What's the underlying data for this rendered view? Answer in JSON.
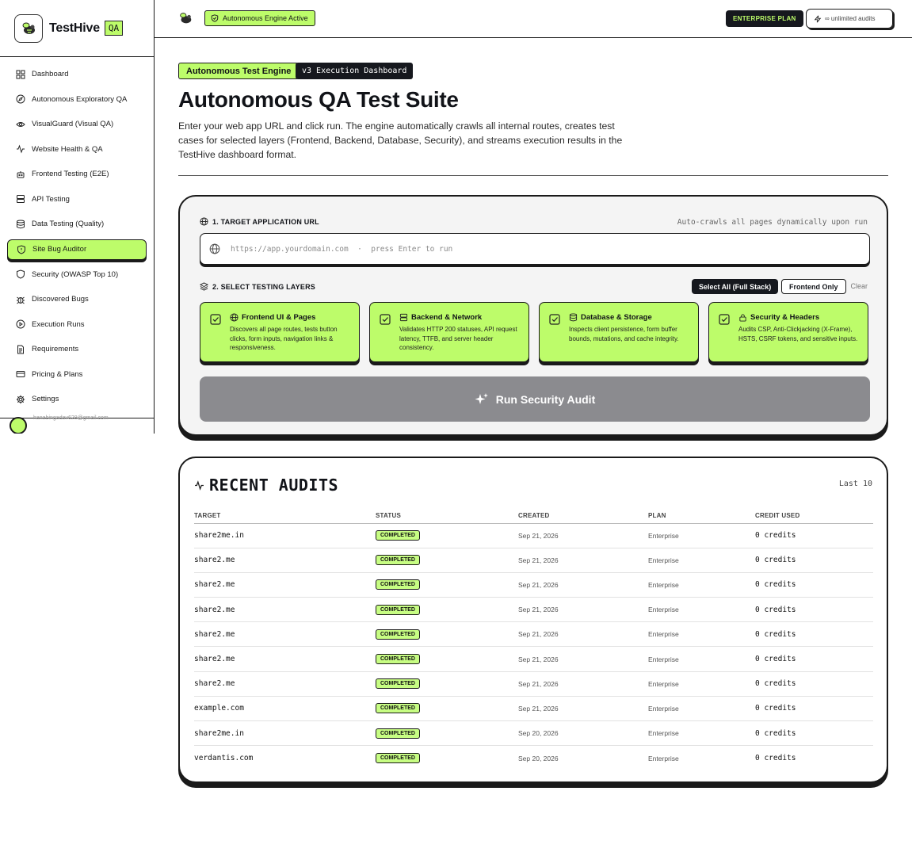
{
  "brand": {
    "name": "TestHive",
    "badge": "QA"
  },
  "sidebar": {
    "items": [
      {
        "label": "Dashboard",
        "icon": "grid-icon"
      },
      {
        "label": "Autonomous Exploratory QA",
        "icon": "compass-icon"
      },
      {
        "label": "VisualGuard (Visual QA)",
        "icon": "eye-icon"
      },
      {
        "label": "Website Health & QA",
        "icon": "activity-icon"
      },
      {
        "label": "Frontend Testing (E2E)",
        "icon": "robot-icon"
      },
      {
        "label": "API Testing",
        "icon": "server-icon"
      },
      {
        "label": "Data Testing (Quality)",
        "icon": "database-icon"
      },
      {
        "label": "Site Bug Auditor",
        "icon": "shield-icon",
        "active": true
      },
      {
        "label": "Security (OWASP Top 10)",
        "icon": "shield-check-icon"
      },
      {
        "label": "Discovered Bugs",
        "icon": "bug-icon"
      },
      {
        "label": "Execution Runs",
        "icon": "play-circle-icon"
      },
      {
        "label": "Requirements",
        "icon": "document-icon"
      },
      {
        "label": "Pricing & Plans",
        "icon": "credit-card-icon"
      },
      {
        "label": "Settings",
        "icon": "gear-icon"
      }
    ],
    "user_email": "hanabingadav628@gmail.com"
  },
  "topbar": {
    "engine_status": "Autonomous Engine Active",
    "plan": "ENTERPRISE PLAN",
    "audits": "∞ unlimited audits"
  },
  "header": {
    "chip_primary": "Autonomous Test Engine",
    "chip_secondary": "v3 Execution Dashboard",
    "title": "Autonomous QA Test Suite",
    "description": "Enter your web app URL and click run. The engine automatically crawls all internal routes, creates test cases for selected layers (Frontend, Backend, Database, Security), and streams execution results in the TestHive dashboard format."
  },
  "config": {
    "url_label": "1. TARGET APPLICATION URL",
    "url_hint": "Auto-crawls all pages dynamically upon run",
    "url_placeholder": "https://app.yourdomain.com  ·  press Enter to run",
    "layers_label": "2. SELECT TESTING LAYERS",
    "select_all": "Select All (Full Stack)",
    "frontend_only": "Frontend Only",
    "clear": "Clear",
    "layers": [
      {
        "title": "Frontend UI & Pages",
        "icon": "globe-icon",
        "desc": "Discovers all page routes, tests button clicks, form inputs, navigation links & responsiveness.",
        "checked": true
      },
      {
        "title": "Backend & Network",
        "icon": "server-icon",
        "desc": "Validates HTTP 200 statuses, API request latency, TTFB, and server header consistency.",
        "checked": true
      },
      {
        "title": "Database & Storage",
        "icon": "database-icon",
        "desc": "Inspects client persistence, form buffer bounds, mutations, and cache integrity.",
        "checked": true
      },
      {
        "title": "Security & Headers",
        "icon": "lock-icon",
        "desc": "Audits CSP, Anti-Clickjacking (X-Frame), HSTS, CSRF tokens, and sensitive inputs.",
        "checked": true
      }
    ],
    "run_label": "Run Security Audit"
  },
  "audits": {
    "title": "RECENT AUDITS",
    "subtitle": "Last 10",
    "columns": [
      "TARGET",
      "STATUS",
      "CREATED",
      "PLAN",
      "CREDIT USED"
    ],
    "rows": [
      {
        "target": "share2me.in",
        "status": "COMPLETED",
        "created": "Sep 21, 2026",
        "plan": "Enterprise",
        "credits": "0 credits"
      },
      {
        "target": "share2.me",
        "status": "COMPLETED",
        "created": "Sep 21, 2026",
        "plan": "Enterprise",
        "credits": "0 credits"
      },
      {
        "target": "share2.me",
        "status": "COMPLETED",
        "created": "Sep 21, 2026",
        "plan": "Enterprise",
        "credits": "0 credits"
      },
      {
        "target": "share2.me",
        "status": "COMPLETED",
        "created": "Sep 21, 2026",
        "plan": "Enterprise",
        "credits": "0 credits"
      },
      {
        "target": "share2.me",
        "status": "COMPLETED",
        "created": "Sep 21, 2026",
        "plan": "Enterprise",
        "credits": "0 credits"
      },
      {
        "target": "share2.me",
        "status": "COMPLETED",
        "created": "Sep 21, 2026",
        "plan": "Enterprise",
        "credits": "0 credits"
      },
      {
        "target": "share2.me",
        "status": "COMPLETED",
        "created": "Sep 21, 2026",
        "plan": "Enterprise",
        "credits": "0 credits"
      },
      {
        "target": "example.com",
        "status": "COMPLETED",
        "created": "Sep 21, 2026",
        "plan": "Enterprise",
        "credits": "0 credits"
      },
      {
        "target": "share2me.in",
        "status": "COMPLETED",
        "created": "Sep 20, 2026",
        "plan": "Enterprise",
        "credits": "0 credits"
      },
      {
        "target": "verdantis.com",
        "status": "COMPLETED",
        "created": "Sep 20, 2026",
        "plan": "Enterprise",
        "credits": "0 credits"
      }
    ]
  },
  "colors": {
    "accent": "#bdfc6a",
    "dark": "#16181e",
    "run_button": "#8b8b8f"
  }
}
